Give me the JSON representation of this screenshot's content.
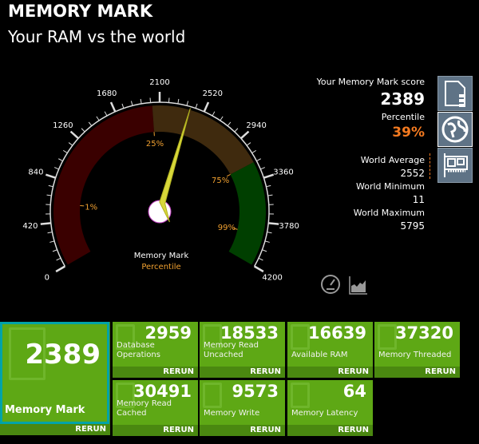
{
  "header": {
    "title": "MEMORY MARK",
    "subtitle": "Your RAM vs the world"
  },
  "gauge": {
    "min": 0,
    "max": 4200,
    "value": 2389,
    "ticks": [
      "0",
      "420",
      "840",
      "1260",
      "1680",
      "2100",
      "2520",
      "2940",
      "3360",
      "3780",
      "4200"
    ],
    "percentile_marks": [
      {
        "label": "1%",
        "value": 600
      },
      {
        "label": "25%",
        "value": 2030
      },
      {
        "label": "75%",
        "value": 3190
      },
      {
        "label": "99%",
        "value": 3900
      }
    ],
    "bands": [
      {
        "from": 0,
        "to": 2030,
        "color": "#3a0000"
      },
      {
        "from": 2030,
        "to": 3190,
        "color": "#3f2a0e"
      },
      {
        "from": 3190,
        "to": 4200,
        "color": "#003f00"
      }
    ],
    "label": "Memory Mark",
    "sublabel": "Percentile"
  },
  "score": {
    "score_label": "Your Memory Mark score",
    "score": "2389",
    "percentile_label": "Percentile",
    "percentile": "39%",
    "avg_label": "World Average",
    "avg": "2552",
    "min_label": "World Minimum",
    "min": "11",
    "max_label": "World Maximum",
    "max": "5795"
  },
  "side_icons": [
    "document-icon",
    "globe-icon",
    "ram-card-icon"
  ],
  "bottom_icons": [
    "speedometer-icon",
    "chart-icon"
  ],
  "main_tile": {
    "value": "2389",
    "label": "Memory Mark",
    "rerun": "RERUN"
  },
  "tiles": [
    {
      "value": "2959",
      "label": "Database Operations",
      "rerun": "RERUN"
    },
    {
      "value": "18533",
      "label": "Memory Read Uncached",
      "rerun": "RERUN"
    },
    {
      "value": "16639",
      "label": "Available RAM",
      "rerun": "RERUN"
    },
    {
      "value": "37320",
      "label": "Memory Threaded",
      "rerun": "RERUN"
    },
    {
      "value": "30491",
      "label": "Memory Read Cached",
      "rerun": "RERUN"
    },
    {
      "value": "9573",
      "label": "Memory Write",
      "rerun": "RERUN"
    },
    {
      "value": "64",
      "label": "Memory Latency",
      "rerun": "RERUN"
    }
  ],
  "colors": {
    "accent": "#f47a20",
    "tile": "#5ea815",
    "selected_border": "#00a3a8"
  }
}
